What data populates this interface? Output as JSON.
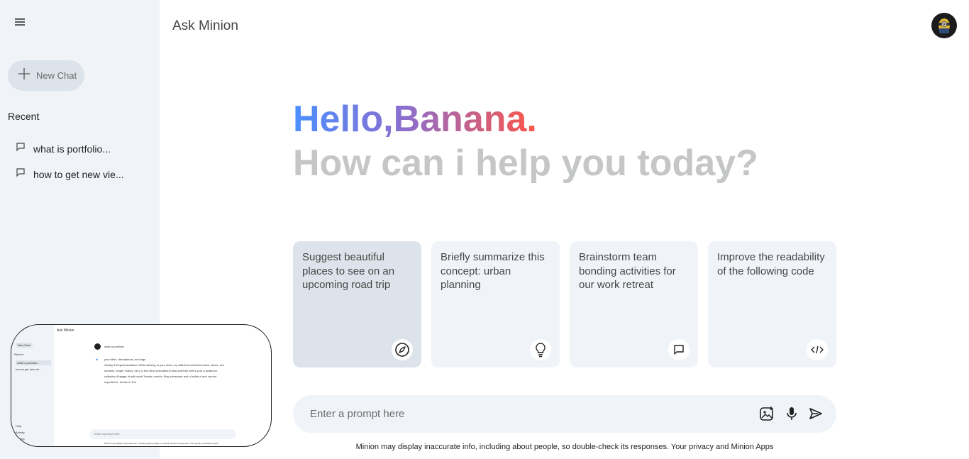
{
  "sidebar": {
    "new_chat_label": "New Chat",
    "recent_title": "Recent",
    "recent": [
      {
        "label": "what is portfolio..."
      },
      {
        "label": "how to get new vie..."
      }
    ]
  },
  "header": {
    "title": "Ask Minion"
  },
  "greeting": {
    "hello": "Hello,Banana.",
    "sub": "How can i help you today?"
  },
  "cards": [
    {
      "text": "Suggest beautiful places to see on an upcoming road trip",
      "icon": "compass-icon"
    },
    {
      "text": "Briefly summarize this concept: urban planning",
      "icon": "bulb-icon"
    },
    {
      "text": "Brainstorm team bonding activities for our work retreat",
      "icon": "message-icon"
    },
    {
      "text": "Improve the readability of the following code",
      "icon": "code-icon"
    }
  ],
  "prompt": {
    "placeholder": "Enter a prompt here"
  },
  "footer": "Minion may display inaccurate info, including about people, so double-check its responses. Your privacy and Minion Apps",
  "thumbnail": {
    "title": "Ask Minion",
    "new_chat": "New Chat",
    "recent": "Recent",
    "items": [
      "what is portfolio...",
      "how to get new vie..."
    ],
    "question": "what is portfolio",
    "answer_lines": [
      "your titles, descriptions, and tags.",
      "Variety & Experimentation: While sticking to your niche, try different content formats: shorts, live",
      "streams, longer videos, etc.) to see what resonates A best portfolio with a your a audience.",
      "collection Engage of with work Trends: used to Stay showcase and of skills of and current",
      "experience. trends in The"
    ],
    "bottom_nav": [
      "Help",
      "Activity",
      "Setting"
    ],
    "prompt_placeholder": "Enter a prompt here",
    "footer": "Minion may display inaccurate info, including about people, so double check its responses. Your privacy and Minion Apps"
  },
  "colors": {
    "sidebar_bg": "#f0f4f9",
    "card_bg": "#f0f4f9",
    "card_active_bg": "#dde3ea",
    "gradient": [
      "#4b90ff",
      "#ff5546"
    ],
    "muted_heading": "#c4c7c5"
  }
}
